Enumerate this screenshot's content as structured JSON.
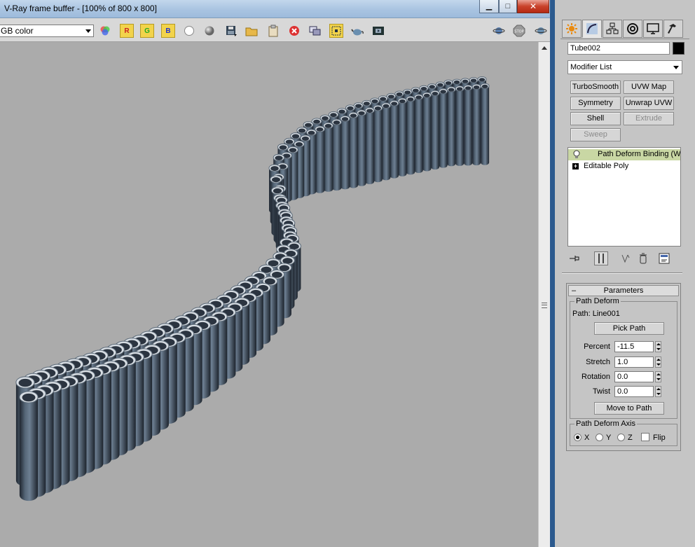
{
  "vfb": {
    "title": "V-Ray frame buffer - [100% of 800 x 800]",
    "channel": "RGB color",
    "channel_shown": "GB color",
    "toolbar": {
      "r_label": "R",
      "g_label": "G",
      "b_label": "B",
      "stop_label": "STOP"
    }
  },
  "command_panel": {
    "object_name": "Tube002",
    "object_color": "#000000",
    "modifier_list": "Modifier List",
    "modifier_buttons": [
      "TurboSmooth",
      "UVW Map",
      "Symmetry",
      "Unwrap UVW",
      "Shell",
      "Extrude",
      "Sweep"
    ],
    "stack": [
      {
        "label": "Path Deform Binding (WS",
        "selected": true
      },
      {
        "label": "Editable Poly",
        "selected": false
      }
    ],
    "parameters": {
      "title": "Parameters",
      "group_title": "Path Deform",
      "path_label": "Path: Line001",
      "pick_path": "Pick Path",
      "percent_label": "Percent",
      "percent": "-11.5",
      "stretch_label": "Stretch",
      "stretch": "1.0",
      "rotation_label": "Rotation",
      "rotation": "0.0",
      "twist_label": "Twist",
      "twist": "0.0",
      "move_to_path": "Move to Path",
      "axis_group": "Path Deform Axis",
      "axis_options": [
        "X",
        "Y",
        "Z"
      ],
      "axis_selected": "X",
      "flip_label": "Flip",
      "flip_checked": false
    }
  }
}
